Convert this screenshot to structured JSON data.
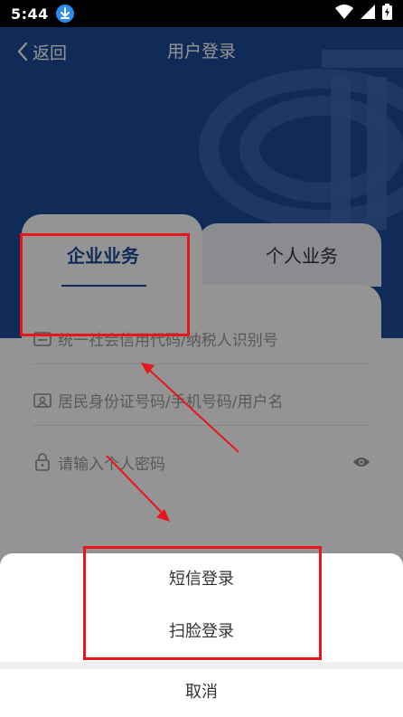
{
  "status_bar": {
    "time": "5:44",
    "icons": [
      "download-icon",
      "wifi-icon",
      "signal-icon",
      "battery-charging-icon"
    ]
  },
  "nav": {
    "back_label": "返回",
    "title": "用户登录"
  },
  "login_card": {
    "tabs": [
      {
        "label": "企业业务",
        "active": true
      },
      {
        "label": "个人业务",
        "active": false
      }
    ],
    "fields": [
      {
        "icon": "id-card-icon",
        "placeholder": "统一社会信用代码/纳税人识别号"
      },
      {
        "icon": "user-card-icon",
        "placeholder": "居民身份证号码/手机号码/用户名"
      },
      {
        "icon": "lock-icon",
        "placeholder": "请输入个人密码",
        "trailing_icon": "eye-icon"
      }
    ]
  },
  "action_sheet": {
    "options": [
      "短信登录",
      "扫脸登录"
    ],
    "cancel": "取消"
  },
  "colors": {
    "brand_blue": "#1e4a9a",
    "annotation_red": "#e8161a"
  }
}
